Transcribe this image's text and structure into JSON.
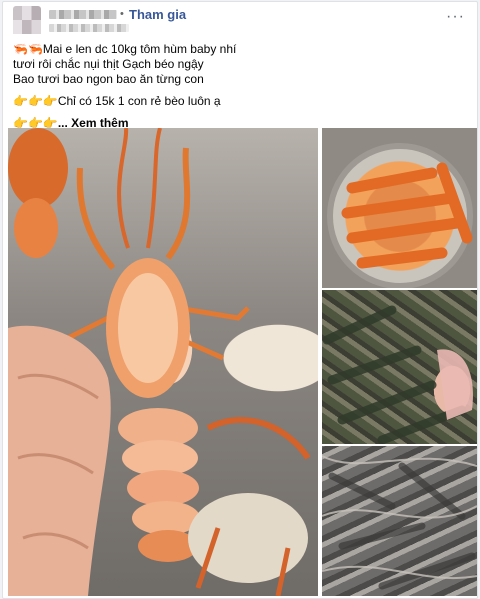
{
  "post": {
    "join_label": "Tham gia",
    "dot": "•",
    "more_label": "···",
    "lines": {
      "l1_emoji": "🦐🦐",
      "l1_text": "Mai e len dc 10kg tôm hùm baby nhí",
      "l2": "tươi rôi chắc nụi thịt Gạch béo ngậy",
      "l3": " Bao tươi bao ngon bao ăn từng con",
      "l4_emoji": "👉👉👉",
      "l4_text": "Chỉ có 15k 1 con rẻ bèo luôn ạ",
      "l5_emoji": "👉👉👉",
      "see_more": "... Xem thêm"
    }
  },
  "colors": {
    "link_blue": "#385898",
    "page_bg": "#f0f2f5",
    "lobster_orange": "#e8742f"
  }
}
